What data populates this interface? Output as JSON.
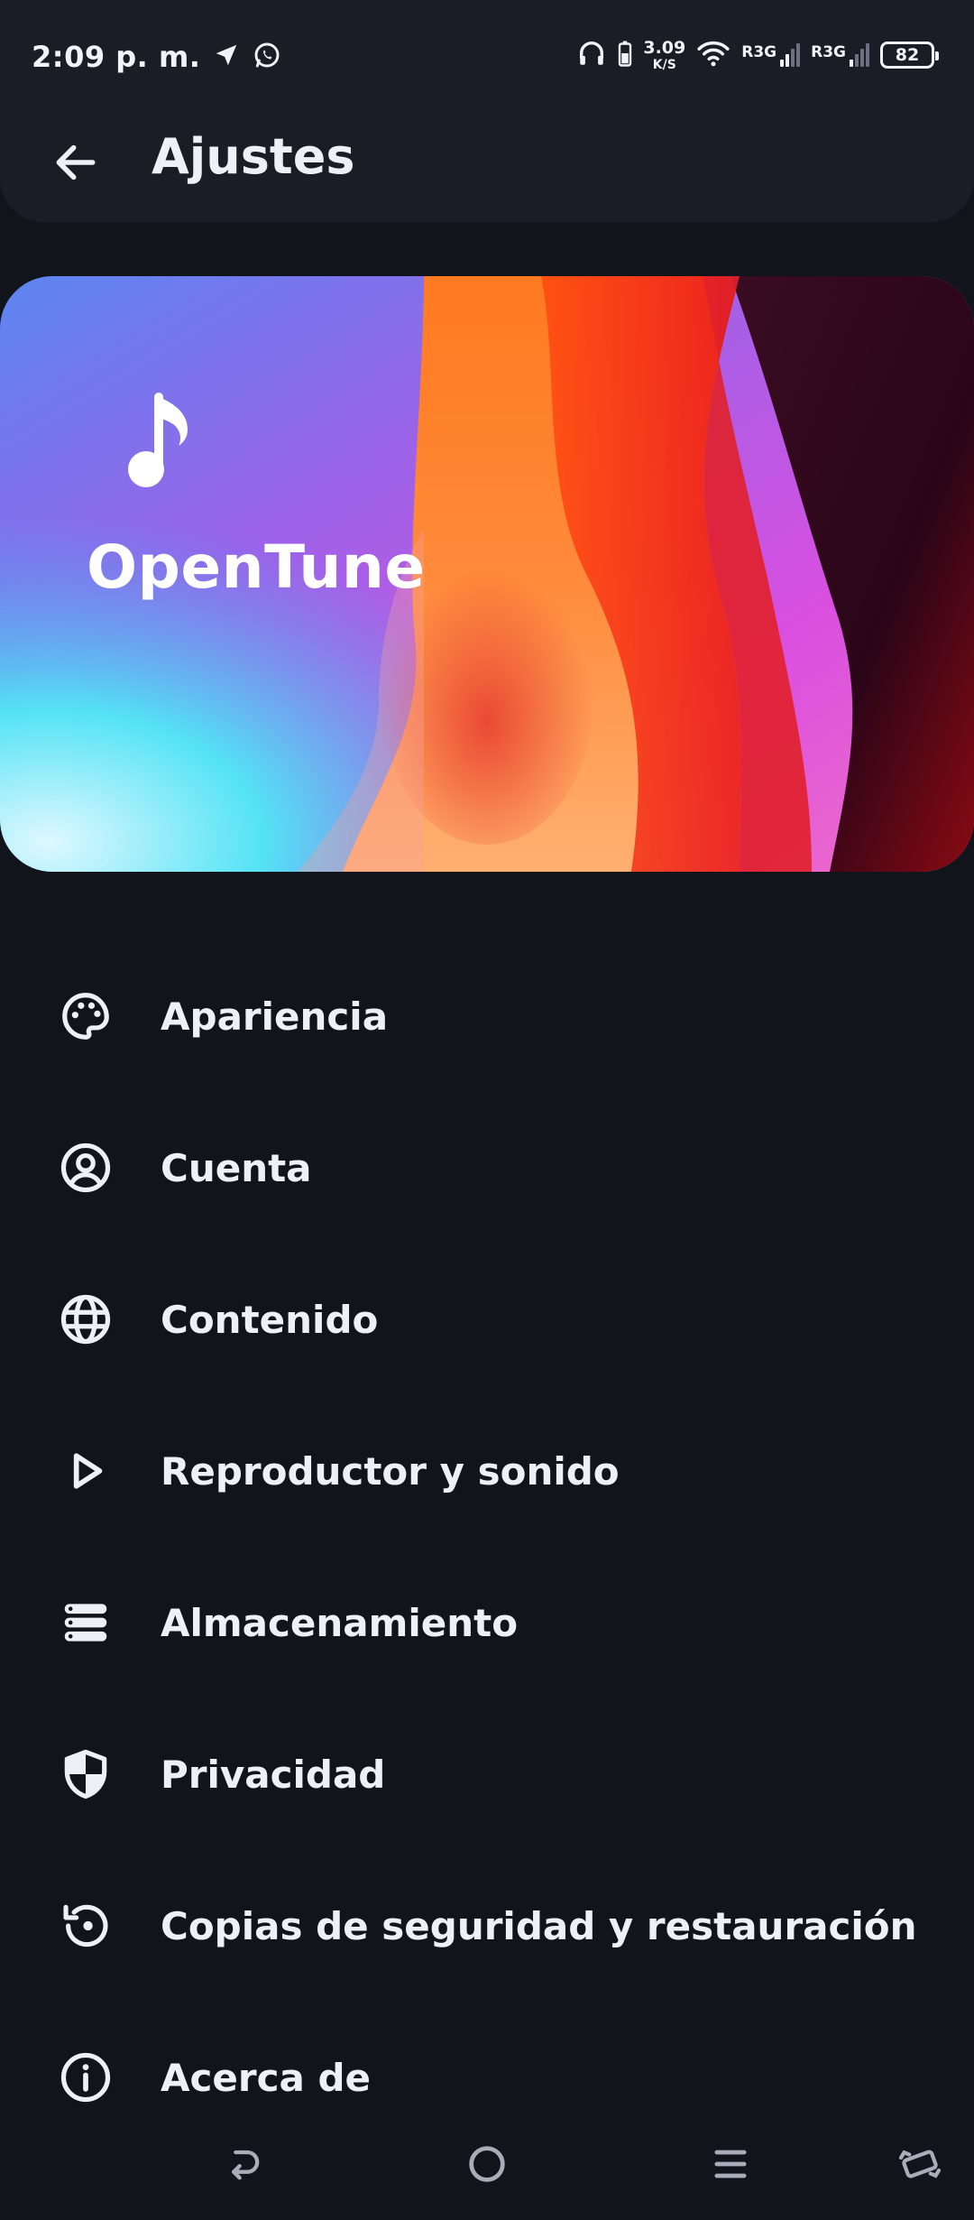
{
  "status_bar": {
    "time": "2:09 p. m.",
    "net_speed_value": "3.09",
    "net_speed_unit": "K/S",
    "sim1_label": "R3G",
    "sim2_label": "R3G",
    "battery": "82"
  },
  "app_bar": {
    "title": "Ajustes"
  },
  "hero": {
    "app_name": "OpenTune"
  },
  "settings": {
    "items": [
      {
        "label": "Apariencia",
        "icon": "palette-icon"
      },
      {
        "label": "Cuenta",
        "icon": "account-circle-icon"
      },
      {
        "label": "Contenido",
        "icon": "globe-icon"
      },
      {
        "label": "Reproductor y sonido",
        "icon": "play-icon"
      },
      {
        "label": "Almacenamiento",
        "icon": "storage-icon"
      },
      {
        "label": "Privacidad",
        "icon": "shield-icon"
      },
      {
        "label": "Copias de seguridad y restauración",
        "icon": "restore-icon"
      },
      {
        "label": "Acerca de",
        "icon": "info-icon"
      }
    ]
  },
  "colors": {
    "background": "#12141c",
    "surface": "#1b1d26",
    "text": "#eef0f6"
  }
}
